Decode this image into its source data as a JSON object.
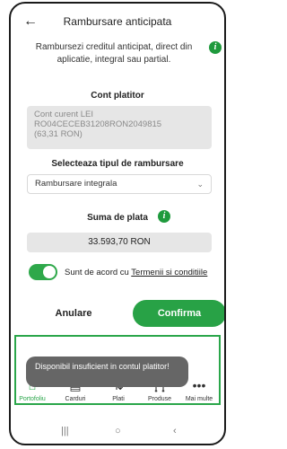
{
  "header": {
    "back_icon": "arrow-left-icon",
    "title": "Rambursare anticipata"
  },
  "intro": {
    "text": "Rambursezi creditul anticipat, direct din aplicatie, integral sau partial."
  },
  "payer_account": {
    "label": "Cont platitor",
    "line1": "Cont curent LEI",
    "line2": "RO04CECEB31208RON2049815",
    "line3": "(63,31 RON)"
  },
  "repayment_type": {
    "label": "Selecteaza tipul de rambursare",
    "value": "Rambursare integrala"
  },
  "amount": {
    "label": "Suma de plata",
    "value": "33.593,70 RON"
  },
  "terms": {
    "prefix": "Sunt de acord cu ",
    "link": "Termenii si conditiile",
    "accepted": true
  },
  "actions": {
    "cancel": "Anulare",
    "confirm": "Confirma"
  },
  "toast": {
    "message": "Disponibil insuficient in contul platitor!"
  },
  "bottom_nav": [
    {
      "label": "Portofoliu",
      "icon": "home-icon",
      "active": true
    },
    {
      "label": "Carduri",
      "icon": "card-icon",
      "active": false
    },
    {
      "label": "Plati",
      "icon": "transfer-icon",
      "active": false
    },
    {
      "label": "Produse",
      "icon": "bank-icon",
      "active": false
    },
    {
      "label": "Mai multe",
      "icon": "more-icon",
      "active": false
    }
  ],
  "colors": {
    "accent": "#28a246",
    "toast_bg": "#666666",
    "field_bg": "#e6e6e6"
  }
}
